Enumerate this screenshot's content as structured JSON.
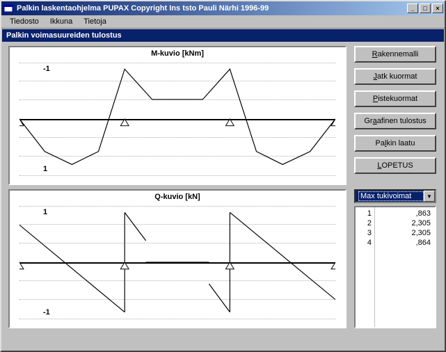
{
  "window": {
    "title": "Palkin laskentaohjelma  PUPAX  Copyright Ins tsto Pauli Närhi 1996-99",
    "subtitle": "Palkin voimasuureiden tulostus"
  },
  "menu": {
    "file": "Tiedosto",
    "window": "Ikkuna",
    "about": "Tietoja"
  },
  "buttons": {
    "rakennemalli": "Rakennemalli",
    "jatk_kuormat": "Jatk kuormat",
    "pistekuormat": "Pistekuormat",
    "graafinen": "Graafinen tulostus",
    "palkin_laatu": "Palkin laatu",
    "lopetus": "LOPETUS"
  },
  "dropdown": {
    "selected": "Max tukivoimat"
  },
  "reactions": {
    "indices": [
      "1",
      "2",
      "3",
      "4"
    ],
    "values": [
      ",863",
      "2,305",
      "2,305",
      ",864"
    ]
  },
  "chart_data": [
    {
      "type": "line",
      "title": "M-kuvio [kNm]",
      "ylabel_top": "-1",
      "ylabel_bot": "1",
      "ylim": [
        -1.3,
        1.3
      ],
      "supports_x": [
        0,
        0.333,
        0.666,
        1.0
      ],
      "series": [
        {
          "name": "M",
          "x": [
            0,
            0.08,
            0.166,
            0.25,
            0.333,
            0.42,
            0.5,
            0.58,
            0.666,
            0.75,
            0.833,
            0.92,
            1.0
          ],
          "y": [
            0,
            0.75,
            1.05,
            0.75,
            -1.15,
            -0.45,
            -0.45,
            -0.45,
            -1.15,
            0.75,
            1.05,
            0.75,
            0
          ]
        }
      ]
    },
    {
      "type": "line",
      "title": "Q-kuvio [kN]",
      "ylabel_top": "1",
      "ylabel_bot": "-1",
      "ylim": [
        -1.3,
        1.3
      ],
      "supports_x": [
        0,
        0.333,
        0.666,
        1.0
      ],
      "series": [
        {
          "name": "Q",
          "segments": [
            {
              "x": [
                0,
                0.333
              ],
              "y": [
                0.86,
                -1.15
              ]
            },
            {
              "x": [
                0.333,
                0.333
              ],
              "y": [
                -1.15,
                1.15
              ]
            },
            {
              "x": [
                0.333,
                0.4
              ],
              "y": [
                1.15,
                0.5
              ]
            },
            {
              "x": [
                0.4,
                0.6
              ],
              "y": [
                0,
                0
              ]
            },
            {
              "x": [
                0.6,
                0.666
              ],
              "y": [
                -0.5,
                -1.15
              ]
            },
            {
              "x": [
                0.666,
                0.666
              ],
              "y": [
                -1.15,
                1.15
              ]
            },
            {
              "x": [
                0.666,
                1.0
              ],
              "y": [
                1.15,
                -0.86
              ]
            }
          ]
        }
      ]
    }
  ]
}
